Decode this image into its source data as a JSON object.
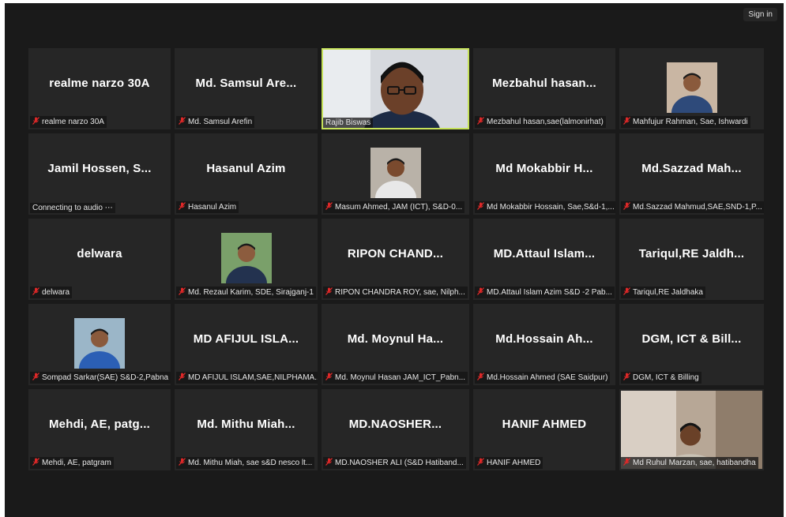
{
  "topbar": {
    "sign_in": "Sign in"
  },
  "icons": {
    "muted": "mic-muted-icon"
  },
  "colors": {
    "background": "#1a1a1a",
    "tile": "#262626",
    "active_speaker": "#c6e25a",
    "muted": "#e02828"
  },
  "participants": [
    {
      "display": "realme narzo 30A",
      "caption": "realme narzo 30A",
      "muted": true
    },
    {
      "display": "Md. Samsul Are...",
      "caption": "Md. Samsul Arefin",
      "muted": true
    },
    {
      "display": "",
      "caption": "Rajib Biswas",
      "muted": false,
      "video": true,
      "active": true
    },
    {
      "display": "Mezbahul hasan...",
      "caption": "Mezbahul hasan,sae(lalmonirhat)",
      "muted": true
    },
    {
      "display": "",
      "caption": "Mahfujur Rahman, Sae, Ishwardi",
      "muted": true,
      "photo": true
    },
    {
      "display": "Jamil Hossen, S...",
      "caption": "Connecting to audio ⋯",
      "muted": false
    },
    {
      "display": "Hasanul Azim",
      "caption": "Hasanul Azim",
      "muted": true
    },
    {
      "display": "",
      "caption": "Masum Ahmed, JAM (ICT), S&D-0...",
      "muted": true,
      "photo": true
    },
    {
      "display": "Md Mokabbir H...",
      "caption": "Md Mokabbir Hossain, Sae,S&d-1,...",
      "muted": true
    },
    {
      "display": "Md.Sazzad Mah...",
      "caption": "Md.Sazzad Mahmud,SAE,SND-1,P...",
      "muted": true
    },
    {
      "display": "delwara",
      "caption": "delwara",
      "muted": true
    },
    {
      "display": "",
      "caption": "Md. Rezaul Karim, SDE, Sirajganj-1",
      "muted": true,
      "photo": true
    },
    {
      "display": "RIPON CHAND...",
      "caption": "RIPON CHANDRA ROY, sae, Nilph...",
      "muted": true
    },
    {
      "display": "MD.Attaul Islam...",
      "caption": "MD.Attaul Islam Azim S&D -2 Pab...",
      "muted": true
    },
    {
      "display": "Tariqul,RE Jaldh...",
      "caption": "Tariqul,RE Jaldhaka",
      "muted": true
    },
    {
      "display": "",
      "caption": "Sompad Sarkar(SAE) S&D-2,Pabna",
      "muted": true,
      "photo": true
    },
    {
      "display": "MD AFIJUL ISLA...",
      "caption": "MD AFIJUL ISLAM,SAE,NILPHAMA...",
      "muted": true
    },
    {
      "display": "Md. Moynul Ha...",
      "caption": "Md. Moynul Hasan JAM_ICT_Pabn...",
      "muted": true
    },
    {
      "display": "Md.Hossain Ah...",
      "caption": "Md.Hossain Ahmed (SAE Saidpur)",
      "muted": true
    },
    {
      "display": "DGM, ICT & Bill...",
      "caption": "DGM, ICT & Billing",
      "muted": true
    },
    {
      "display": "Mehdi, AE, patg...",
      "caption": "Mehdi, AE, patgram",
      "muted": true
    },
    {
      "display": "Md. Mithu Miah...",
      "caption": "Md. Mithu Miah, sae s&D nesco lt...",
      "muted": true
    },
    {
      "display": "MD.NAOSHER...",
      "caption": "MD.NAOSHER ALI (S&D Hatiband...",
      "muted": true
    },
    {
      "display": "HANIF AHMED",
      "caption": "HANIF AHMED",
      "muted": true
    },
    {
      "display": "",
      "caption": "Md Ruhul Marzan, sae, hatibandha",
      "muted": true,
      "video": true
    }
  ]
}
